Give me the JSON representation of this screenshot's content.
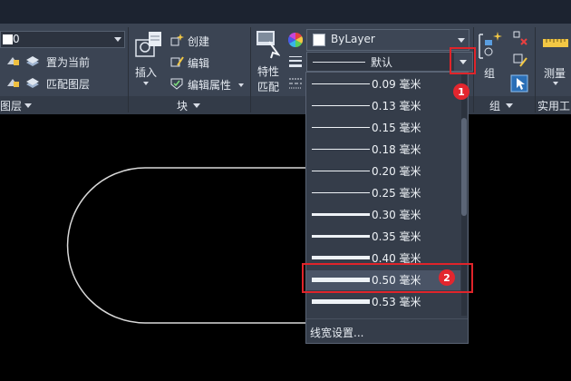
{
  "layer_panel": {
    "current_layer": "0",
    "buttons": [
      "置为当前",
      "匹配图层"
    ],
    "panel_label": "图层"
  },
  "block_panel": {
    "insert_label": "插入",
    "buttons": [
      "创建",
      "编辑",
      "编辑属性"
    ],
    "panel_label": "块"
  },
  "properties_panel": {
    "match_label": "特性\n匹配",
    "match_label_line1": "特性",
    "match_label_line2": "匹配",
    "color_value": "ByLayer",
    "lineweight_value": "默认"
  },
  "lineweight_dropdown": {
    "items": [
      "0.09 毫米",
      "0.13 毫米",
      "0.15 毫米",
      "0.18 毫米",
      "0.20 毫米",
      "0.25 毫米",
      "0.30 毫米",
      "0.35 毫米",
      "0.40 毫米",
      "0.50 毫米",
      "0.53 毫米"
    ],
    "selected_item": "0.50 毫米",
    "footer": "线宽设置..."
  },
  "groups_panel": {
    "group_label": "组",
    "panel_label": "组"
  },
  "utilities_panel": {
    "measure_label": "测量",
    "panel_label": "实用工"
  },
  "annotations": {
    "badge1": "1",
    "badge2": "2"
  },
  "colors": {
    "highlight": "#e0242a",
    "ribbon": "#3b4453",
    "canvas": "#000000"
  }
}
